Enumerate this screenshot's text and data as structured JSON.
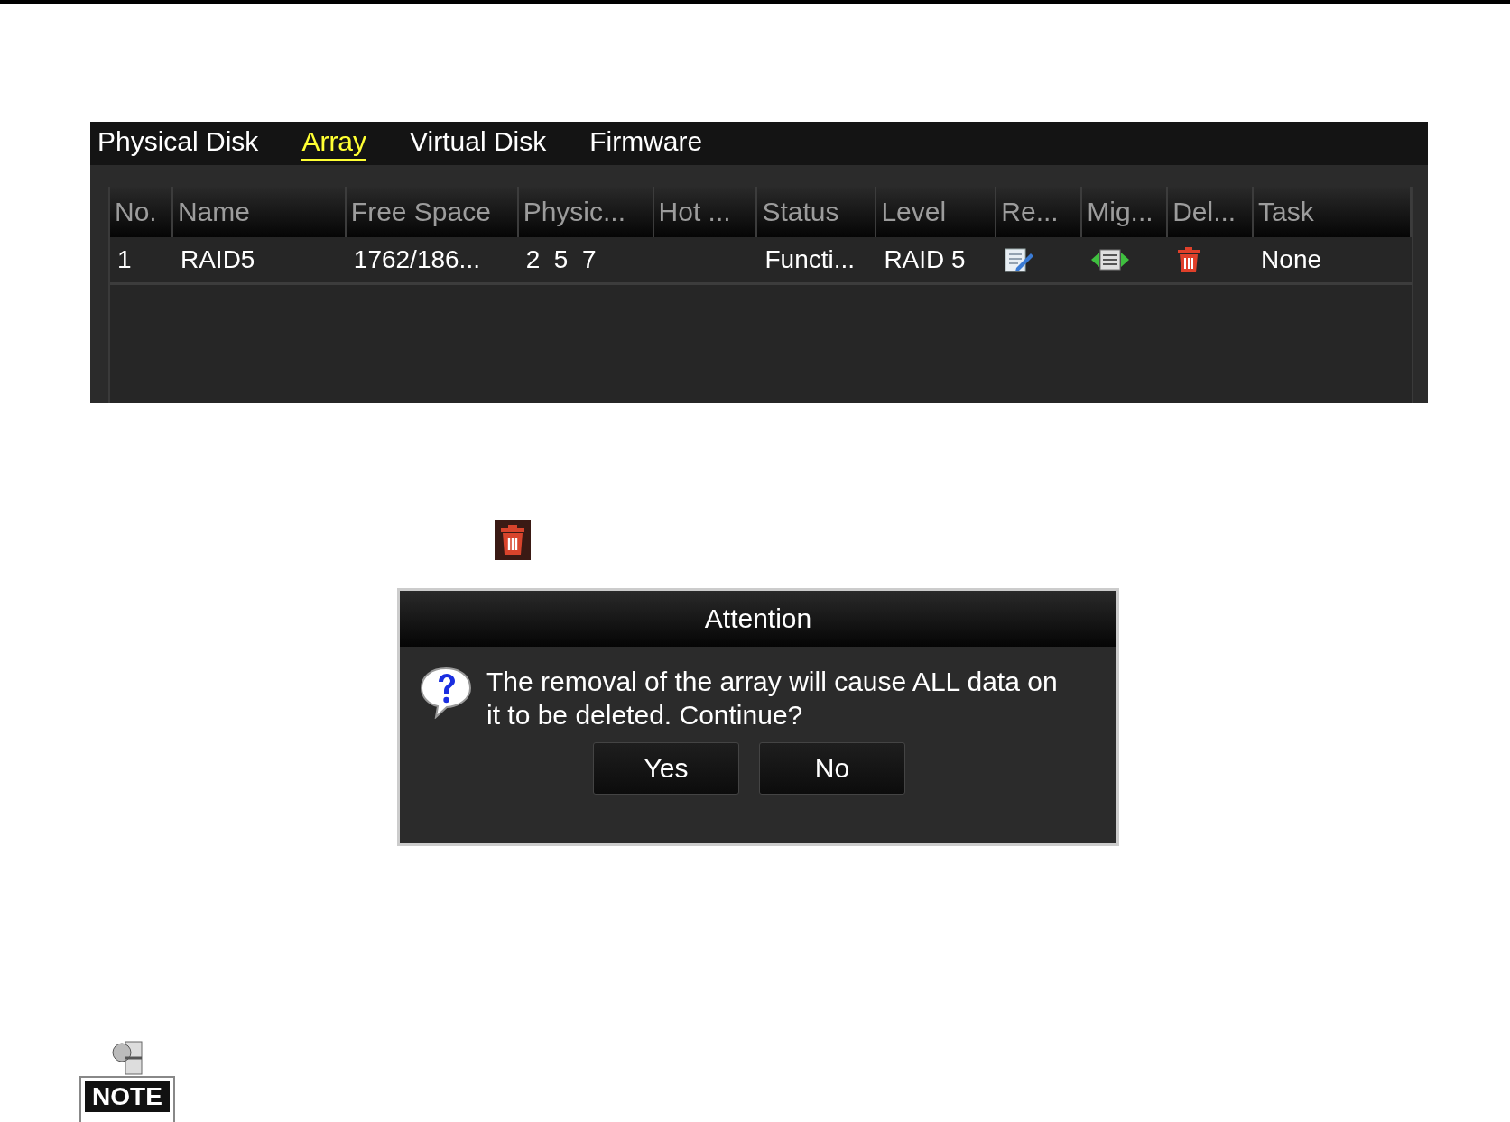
{
  "tabs": [
    {
      "label": "Physical Disk",
      "selected": false
    },
    {
      "label": "Array",
      "selected": true
    },
    {
      "label": "Virtual Disk",
      "selected": false
    },
    {
      "label": "Firmware",
      "selected": false
    }
  ],
  "table": {
    "columns": [
      "No.",
      "Name",
      "Free Space",
      "Physic...",
      "Hot ...",
      "Status",
      "Level",
      "Re...",
      "Mig...",
      "Del...",
      "Task"
    ],
    "rows": [
      {
        "cells": [
          {
            "kind": "text",
            "text": "1"
          },
          {
            "kind": "text",
            "text": "RAID5"
          },
          {
            "kind": "text",
            "text": "1762/186..."
          },
          {
            "kind": "text",
            "text": "2  5  7"
          },
          {
            "kind": "text",
            "text": ""
          },
          {
            "kind": "text",
            "text": "Functi..."
          },
          {
            "kind": "text",
            "text": "RAID 5"
          },
          {
            "kind": "edit"
          },
          {
            "kind": "migrate"
          },
          {
            "kind": "delete"
          },
          {
            "kind": "text",
            "text": "None"
          }
        ]
      }
    ]
  },
  "dialog": {
    "title": "Attention",
    "message": "The removal of the array will cause ALL data on it to be deleted. Continue?",
    "buttons": [
      "Yes",
      "No"
    ]
  },
  "note_label": "NOTE"
}
